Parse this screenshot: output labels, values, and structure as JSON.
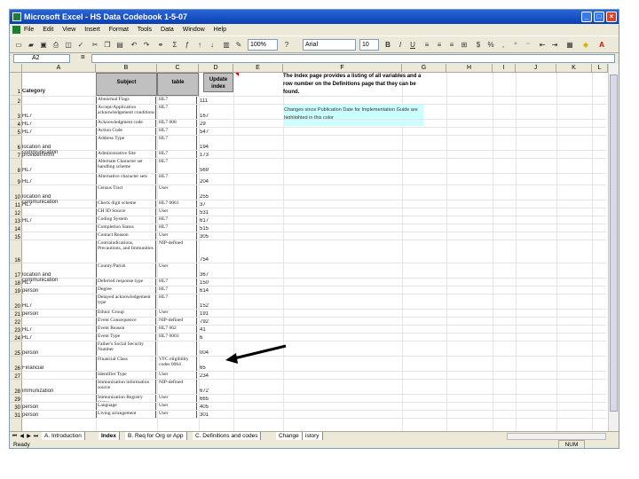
{
  "window": {
    "title": "Microsoft Excel - HS Data Codebook 1-5-07"
  },
  "menu": [
    "File",
    "Edit",
    "View",
    "Insert",
    "Format",
    "Tools",
    "Data",
    "Window",
    "Help"
  ],
  "toolbar": {
    "zoom": "100%",
    "font": "Arial",
    "font_size": "10",
    "bold": "B",
    "italic": "I",
    "underline": "U",
    "currency": "$",
    "percent": "%"
  },
  "formula_bar": {
    "name_box": "A2",
    "fx": "="
  },
  "columns": [
    "A",
    "B",
    "C",
    "D",
    "E",
    "F",
    "G",
    "H",
    "I",
    "J",
    "K",
    "L"
  ],
  "header": {
    "subject": "Subject",
    "table": "table",
    "update_index": "Update index",
    "category": "Category"
  },
  "notes": {
    "index_note": "The Index page provides a listing of all variables and a row number on the Definitions page that they can be found.",
    "changes_note": "Changes since Publication Date for Implementation Guide are highlighted in this color"
  },
  "rows": [
    {
      "n": "2",
      "a": "",
      "b": "Abnormal Flags",
      "c": "HL7",
      "d": "111"
    },
    {
      "n": "3",
      "a": "HL7",
      "b": "Accept/Application acknowledgement conditions",
      "c": "HL7",
      "d": "167"
    },
    {
      "n": "4",
      "a": "HL7",
      "b": "Acknowledgment code",
      "c": "HL7 008",
      "d": "29"
    },
    {
      "n": "5",
      "a": "HL7",
      "b": "Action Code",
      "c": "HL7",
      "d": "547"
    },
    {
      "n": "6",
      "a": "location and communication",
      "b": "Address Type",
      "c": "HL7",
      "d": "194"
    },
    {
      "n": "7",
      "a": "provider/immi",
      "b": "Administrative Site",
      "c": "HL7",
      "d": "173"
    },
    {
      "n": "8",
      "a": "HL7",
      "b": "Alternate Character set handling scheme",
      "c": "HL7",
      "d": "569"
    },
    {
      "n": "9",
      "a": "HL7",
      "b": "Alternative character sets",
      "c": "HL7",
      "d": "204"
    },
    {
      "n": "10",
      "a": "location and communication",
      "b": "Census Tract",
      "c": "User",
      "d": "255"
    },
    {
      "n": "11",
      "a": "HL7",
      "b": "Check digit scheme",
      "c": "HL7 0061",
      "d": "37"
    },
    {
      "n": "12",
      "a": "",
      "b": "CH ID Source",
      "c": "User",
      "d": "531"
    },
    {
      "n": "13",
      "a": "HL7",
      "b": "Coding System",
      "c": "HL7",
      "d": "617"
    },
    {
      "n": "14",
      "a": "",
      "b": "Completion Status",
      "c": "HL7",
      "d": "515"
    },
    {
      "n": "15",
      "a": "",
      "b": "Contact Reason",
      "c": "User",
      "d": "305"
    },
    {
      "n": "16",
      "a": "",
      "b": "Contraindications, Precautions, and Immunities",
      "c": "NIP-defined",
      "d": "754"
    },
    {
      "n": "17",
      "a": "location and communication",
      "b": "County/Parish",
      "c": "User",
      "d": "367"
    },
    {
      "n": "18",
      "a": "HL7",
      "b": "Deferred response type",
      "c": "HL7",
      "d": "150"
    },
    {
      "n": "19",
      "a": "person",
      "b": "Degree",
      "c": "HL7",
      "d": "614"
    },
    {
      "n": "20",
      "a": "HL7",
      "b": "Delayed acknowledgement type",
      "c": "HL7",
      "d": "152"
    },
    {
      "n": "21",
      "a": "person",
      "b": "Ethnic Group",
      "c": "User",
      "d": "191"
    },
    {
      "n": "22",
      "a": "",
      "b": "Event Consequence",
      "c": "NIP-defined",
      "d": "792"
    },
    {
      "n": "23",
      "a": "HL7",
      "b": "Event Reason",
      "c": "HL7 062",
      "d": "41"
    },
    {
      "n": "24",
      "a": "HL7",
      "b": "Event Type",
      "c": "HL7 0003",
      "d": "6"
    },
    {
      "n": "25",
      "a": "person",
      "b": "Father's Social Security Number",
      "c": "",
      "d": "004"
    },
    {
      "n": "26",
      "a": "Financial",
      "b": "Financial Class",
      "c": "VFC eligibility codes 0064",
      "d": "65"
    },
    {
      "n": "27",
      "a": "",
      "b": "Identifier Type",
      "c": "User",
      "d": "234"
    },
    {
      "n": "28",
      "a": "immunization",
      "b": "Immunization information source",
      "c": "NIP-defined",
      "d": "672"
    },
    {
      "n": "29",
      "a": "",
      "b": "Immunization Registry Status",
      "c": "User",
      "d": "665"
    },
    {
      "n": "30",
      "a": "person",
      "b": "Language",
      "c": "User",
      "d": "405"
    },
    {
      "n": "31",
      "a": "person",
      "b": "Living arrangement",
      "c": "User",
      "d": "301"
    }
  ],
  "sheet_tabs": [
    "A. Introduction",
    "Index",
    "B. Req for Org or App",
    "C. Definitions and codes",
    "Change",
    "istory"
  ],
  "status": {
    "ready": "Ready",
    "num": "NUM"
  }
}
